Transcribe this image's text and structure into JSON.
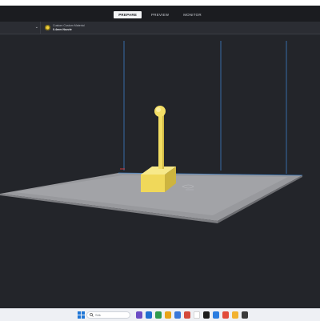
{
  "tabs": [
    {
      "label": "PREPARE",
      "active": true
    },
    {
      "label": "PREVIEW",
      "active": false
    },
    {
      "label": "MONITOR",
      "active": false
    }
  ],
  "material": {
    "line1": "Custom Custom Material",
    "line2": "0.4mm Nozzle",
    "color": "#f4d33b"
  },
  "taskbar": {
    "search_placeholder": "Sök",
    "app_colors": [
      "#6c4dc4",
      "#1f6fd0",
      "#2f9b4d",
      "#e8a317",
      "#3a77d8",
      "#d44a3a",
      "#ffffff",
      "#1c1c1c",
      "#2b7de0",
      "#e24c3a",
      "#f2b230",
      "#3a3a3a"
    ]
  },
  "colors": {
    "app_background": "#23252a",
    "build_plate": "#9fa1a5",
    "build_volume_edge": "#4a90d9",
    "model": "#f6e36a"
  }
}
